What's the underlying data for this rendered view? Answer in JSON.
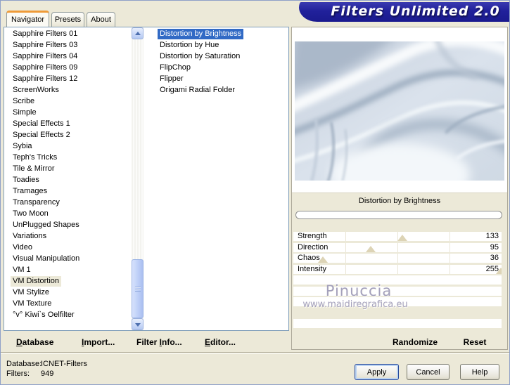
{
  "titlebar": {
    "title": "Filters Unlimited 2.0",
    "banner_color": "#21219b"
  },
  "tabs": [
    {
      "label": "Navigator",
      "active": true
    },
    {
      "label": "Presets",
      "active": false
    },
    {
      "label": "About",
      "active": false
    }
  ],
  "category_list": {
    "items": [
      "Sapphire Filters 01",
      "Sapphire Filters 03",
      "Sapphire Filters 04",
      "Sapphire Filters 09",
      "Sapphire Filters 12",
      "ScreenWorks",
      "Scribe",
      "Simple",
      "Special Effects 1",
      "Special Effects 2",
      "Sybia",
      "Teph's Tricks",
      "Tile & Mirror",
      "Toadies",
      "Tramages",
      "Transparency",
      "Two Moon",
      "UnPlugged Shapes",
      "Variations",
      "Video",
      "Visual Manipulation",
      "VM 1",
      "VM Distortion",
      "VM Stylize",
      "VM Texture",
      "°v° Kiwi`s Oelfilter"
    ],
    "selected": "VM Distortion"
  },
  "filter_list": {
    "items": [
      "Distortion by Brightness",
      "Distortion by Hue",
      "Distortion by Saturation",
      "FlipChop",
      "Flipper",
      "Origami Radial Folder"
    ],
    "selected": "Distortion by Brightness"
  },
  "preview": {
    "caption": "Distortion by Brightness",
    "progress_percent": 0
  },
  "sliders": [
    {
      "label": "Strength",
      "value": 133,
      "max": 255
    },
    {
      "label": "Direction",
      "value": 95,
      "max": 255
    },
    {
      "label": "Chaos",
      "value": 36,
      "max": 255
    },
    {
      "label": "Intensity",
      "value": 255,
      "max": 255
    }
  ],
  "watermark": {
    "line1": "Pinuccia",
    "line2": "www.maidiregrafica.eu"
  },
  "panel_actions": {
    "randomize": "Randomize",
    "reset": "Reset"
  },
  "toolbar": {
    "database": {
      "pre": "",
      "accel": "D",
      "rest": "atabase"
    },
    "import": {
      "pre": "",
      "accel": "I",
      "rest": "mport..."
    },
    "filter_info": {
      "pre": "Filter ",
      "accel": "I",
      "rest": "nfo..."
    },
    "editor": {
      "pre": "",
      "accel": "E",
      "rest": "ditor..."
    }
  },
  "statusbar": {
    "database_label": "Database:",
    "database_value": "ICNET-Filters",
    "filters_label": "Filters:",
    "filters_value": "949"
  },
  "dialog_buttons": {
    "apply": "Apply",
    "cancel": "Cancel",
    "help": "Help"
  },
  "icons": {
    "scroll_up": "chevron-up",
    "scroll_down": "chevron-down",
    "thumb_grip": "grip-lines"
  },
  "colors": {
    "window_bg": "#ece9d8",
    "selection_blue": "#316ac5",
    "inactive_selection": "#ece9d8",
    "tab_accent_orange": "#ef9b38",
    "banner_navy": "#21219b",
    "slider_marker": "#ddd4b6"
  }
}
